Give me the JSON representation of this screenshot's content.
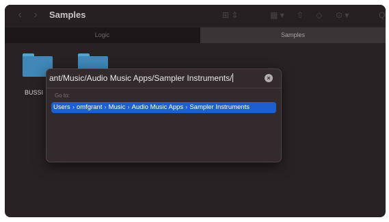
{
  "window": {
    "title": "Samples",
    "back_icon": "chevron-left-icon",
    "forward_icon": "chevron-right-icon"
  },
  "toolbar_icons": [
    {
      "name": "view-grid-icon",
      "glyph": "⊞ ⇕"
    },
    {
      "name": "group-icon",
      "glyph": "▦ ▾"
    },
    {
      "name": "share-icon",
      "glyph": "⇧"
    },
    {
      "name": "tag-icon",
      "glyph": "◇"
    },
    {
      "name": "more-actions-icon",
      "glyph": "⊙ ▾"
    },
    {
      "name": "search-icon",
      "glyph": "Q"
    }
  ],
  "tabs": [
    {
      "label": "Logic",
      "active": false
    },
    {
      "label": "Samples",
      "active": true
    }
  ],
  "folders": [
    {
      "label": "BUSSI"
    },
    {
      "label": ""
    }
  ],
  "goto_dialog": {
    "path_value": "ant/Music/Audio Music Apps/Sampler Instruments/",
    "clear_icon": "close-circle-icon",
    "goto_label": "Go to:",
    "suggestion_crumbs": [
      "Users",
      "omfgrant",
      "Music",
      "Audio Music Apps",
      "Sampler Instruments"
    ],
    "separator": "›"
  },
  "colors": {
    "window_bg": "#282224",
    "dialog_bg": "#332a2d",
    "selection_blue": "#1c5fd1",
    "folder_blue": "#3f88b8"
  }
}
